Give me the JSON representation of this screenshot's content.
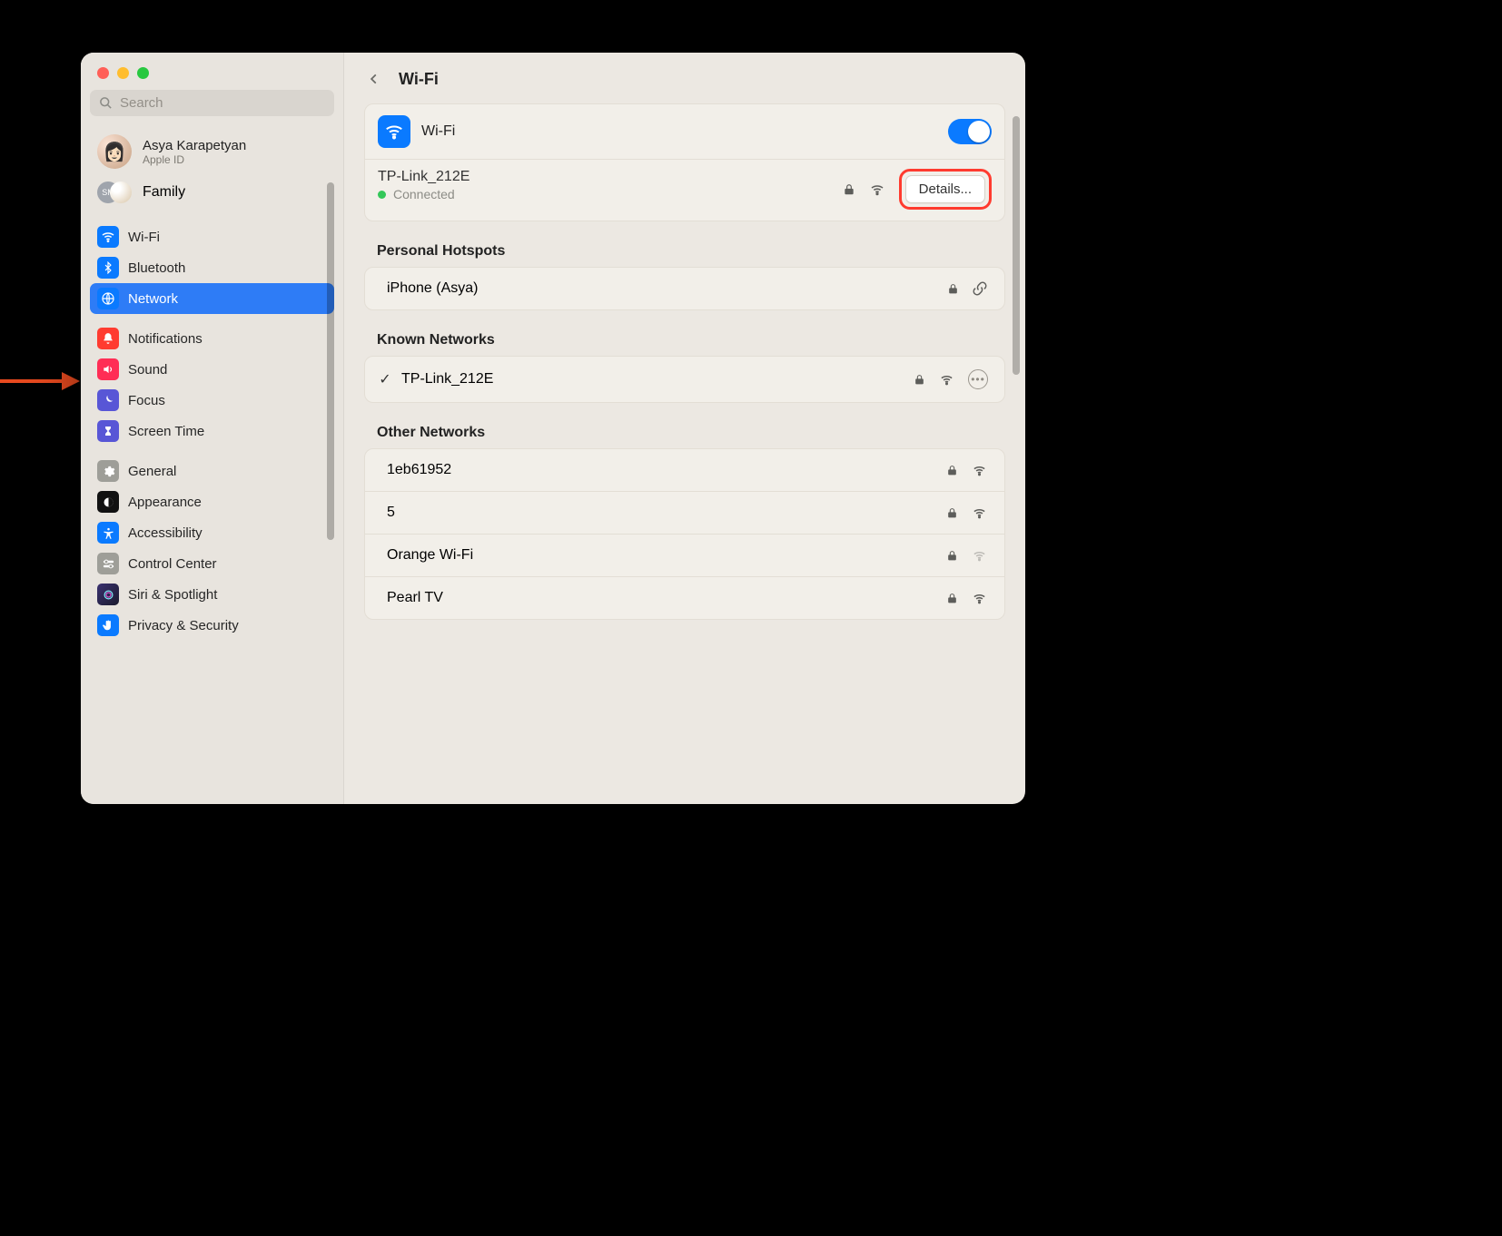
{
  "search": {
    "placeholder": "Search"
  },
  "profile": {
    "name": "Asya Karapetyan",
    "sub": "Apple ID",
    "initials": "SM"
  },
  "family_label": "Family",
  "sidebar": {
    "items": [
      {
        "label": "Wi-Fi"
      },
      {
        "label": "Bluetooth"
      },
      {
        "label": "Network"
      },
      {
        "label": "Notifications"
      },
      {
        "label": "Sound"
      },
      {
        "label": "Focus"
      },
      {
        "label": "Screen Time"
      },
      {
        "label": "General"
      },
      {
        "label": "Appearance"
      },
      {
        "label": "Accessibility"
      },
      {
        "label": "Control Center"
      },
      {
        "label": "Siri & Spotlight"
      },
      {
        "label": "Privacy & Security"
      }
    ]
  },
  "header": {
    "title": "Wi-Fi"
  },
  "wifi": {
    "label": "Wi-Fi",
    "enabled": true,
    "connected": {
      "ssid": "TP-Link_212E",
      "status": "Connected",
      "details_label": "Details..."
    }
  },
  "sections": {
    "hotspots_title": "Personal Hotspots",
    "hotspots": [
      {
        "name": "iPhone (Asya)"
      }
    ],
    "known_title": "Known Networks",
    "known": [
      {
        "name": "TP-Link_212E",
        "checked": true
      }
    ],
    "other_title": "Other Networks",
    "other": [
      {
        "name": "1eb61952",
        "weak": false
      },
      {
        "name": "5",
        "weak": false
      },
      {
        "name": "Orange Wi-Fi",
        "weak": true
      },
      {
        "name": "Pearl TV",
        "weak": false
      }
    ]
  },
  "colors": {
    "accent": "#0a7aff",
    "annotation": "#e84a1f",
    "status_green": "#34c759"
  }
}
